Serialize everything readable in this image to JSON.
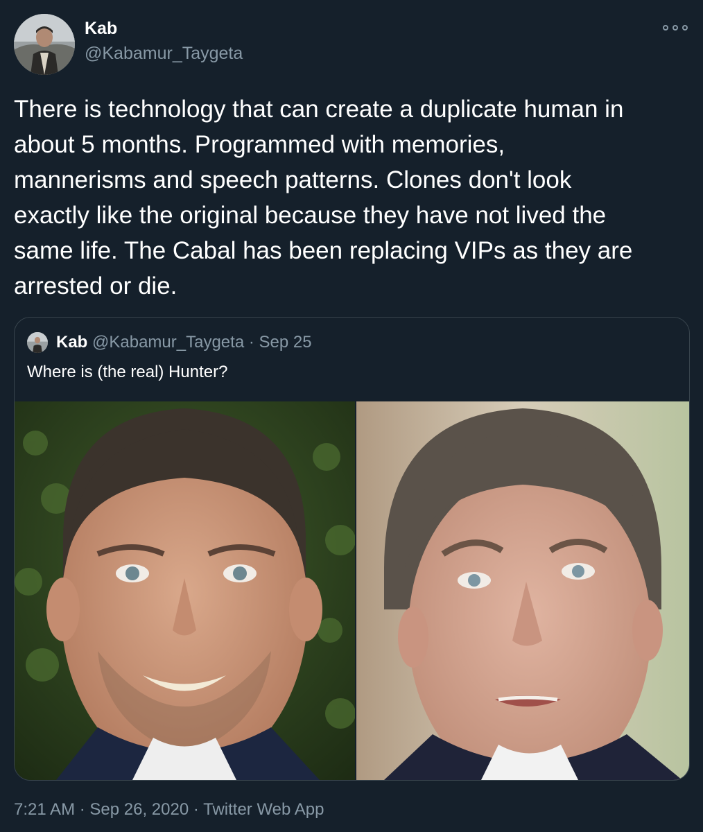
{
  "tweet": {
    "author_name": "Kab",
    "author_handle": "@Kabamur_Taygeta",
    "more_icon": "more-dots-icon",
    "text": "There is technology that can create a duplicate human in\nabout 5 months. Programmed with memories,\nmannerisms and speech patterns. Clones don't look\nexactly like the original because they have not lived the\nsame life. The Cabal has been replacing VIPs as they are\narrested or die.",
    "timestamp": "7:21 AM",
    "separator": "·",
    "date": "Sep 26, 2020",
    "source": "Twitter Web App"
  },
  "quoted": {
    "author_name": "Kab",
    "author_handle": "@Kabamur_Taygeta",
    "separator": "·",
    "date": "Sep 25",
    "text": "Where is (the real) Hunter?",
    "photos": [
      "left-face-photo",
      "right-face-photo"
    ]
  },
  "colors": {
    "background": "#15202b",
    "primary_text": "#ffffff",
    "secondary_text": "#8899a6",
    "border": "#38444d"
  }
}
